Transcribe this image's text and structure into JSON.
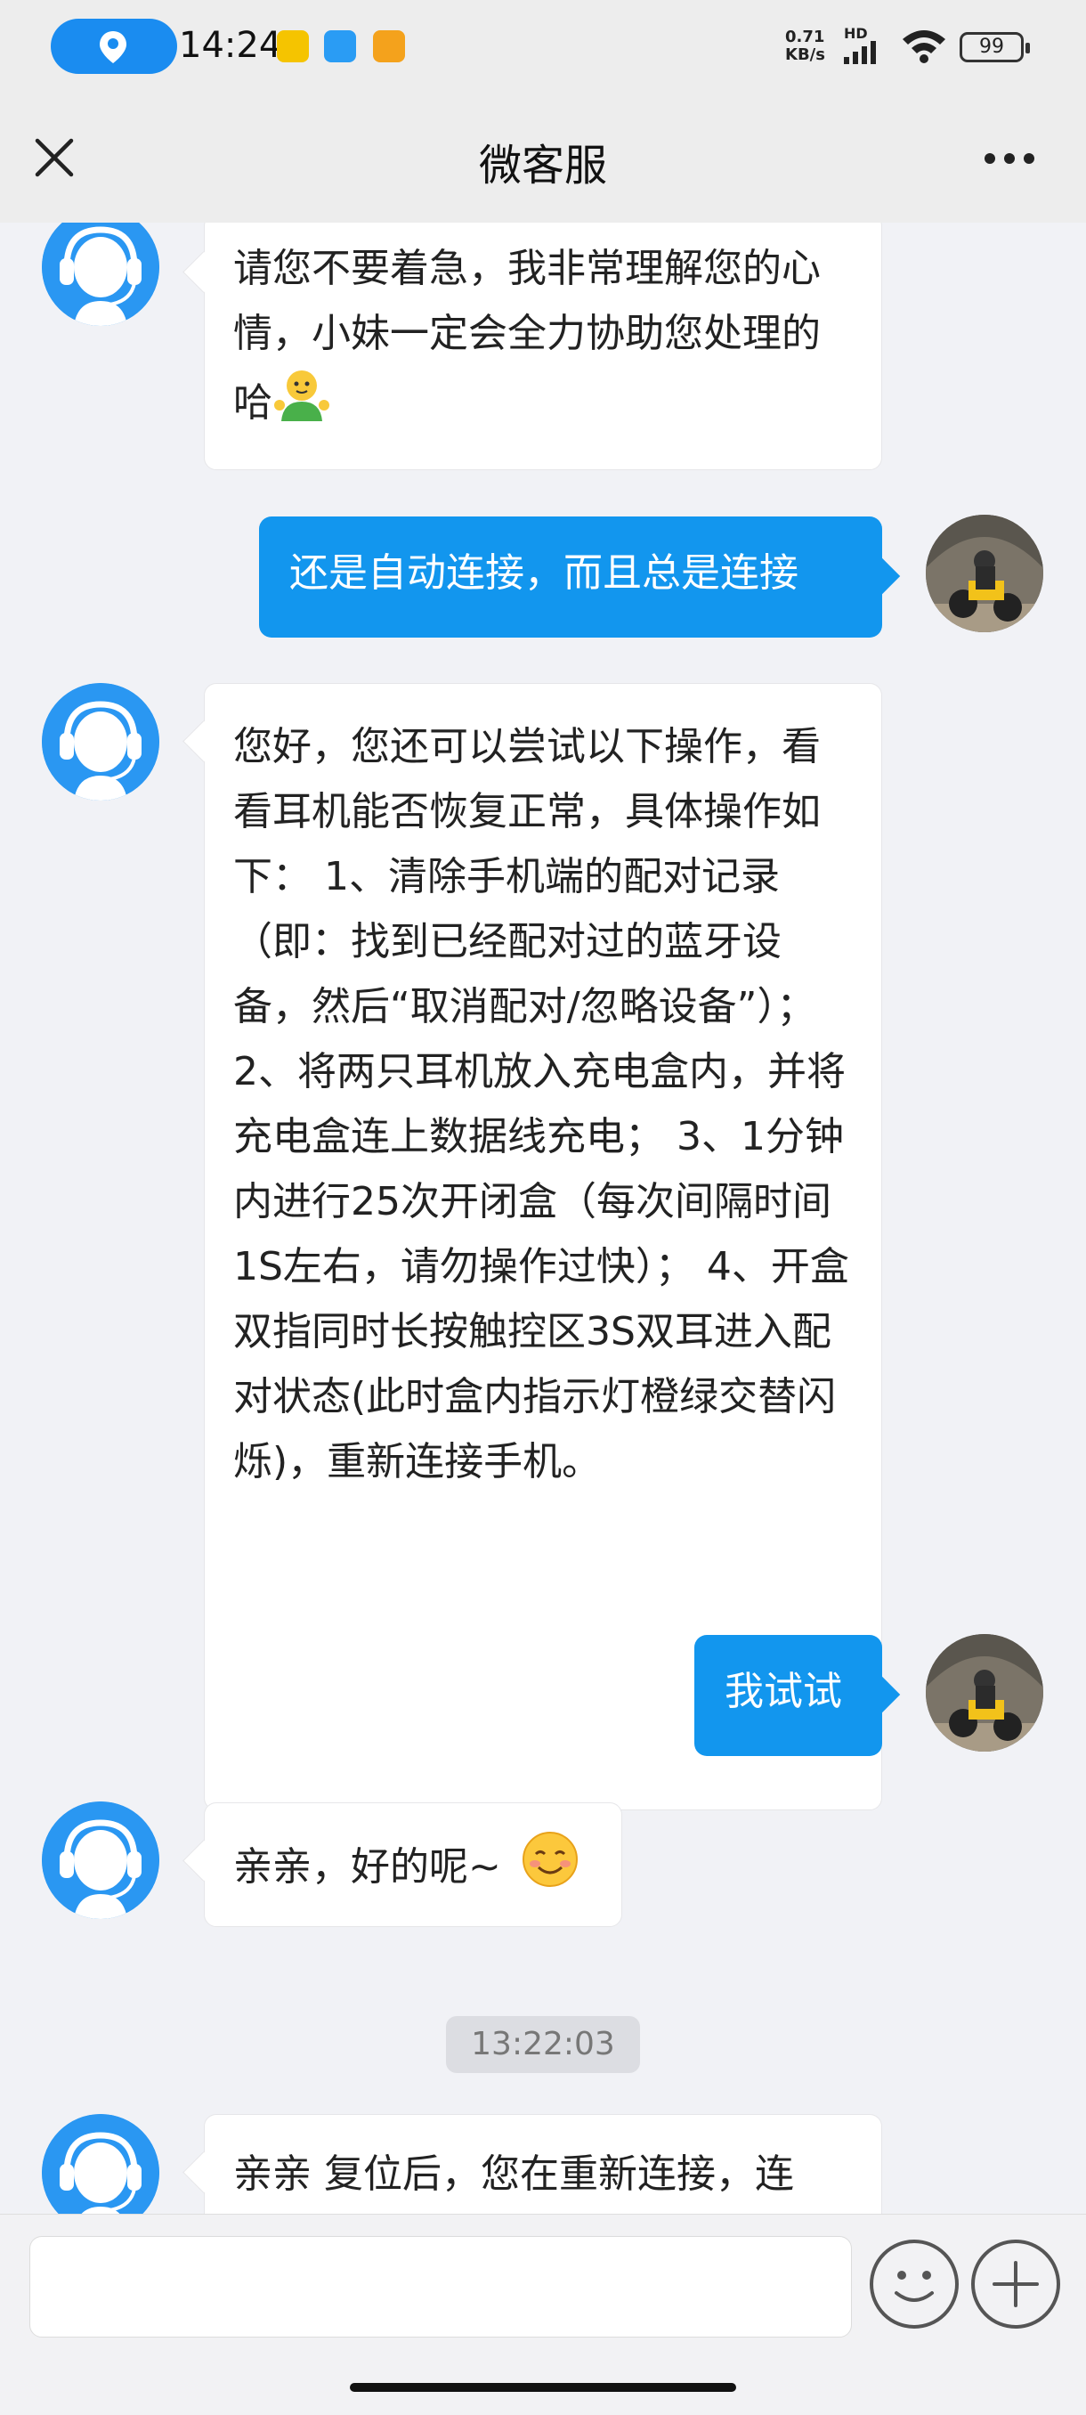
{
  "status_bar": {
    "time": "14:24",
    "network_speed_value": "0.71",
    "network_speed_unit": "KB/s",
    "network_type": "HD",
    "battery": "99"
  },
  "header": {
    "title": "微客服"
  },
  "messages": [
    {
      "side": "left",
      "text": "请您不要着急，我非常理解您的心情，小妹一定会全力协助您处理的哈"
    },
    {
      "side": "right",
      "text": "还是自动连接，而且总是连接"
    },
    {
      "side": "left",
      "text": "您好，您还可以尝试以下操作，看看耳机能否恢复正常，具体操作如下： 1、清除手机端的配对记录（即：找到已经配对过的蓝牙设备，然后“取消配对/忽略设备”）； 2、将两只耳机放入充电盒内，并将充电盒连上数据线充电； 3、1分钟内进行25次开闭盒（每次间隔时间1S左右，请勿操作过快）； 4、开盒双指同时长按触控区3S双耳进入配对状态(此时盒内指示灯橙绿交替闪烁)，重新连接手机。"
    },
    {
      "side": "right",
      "text": "我试试"
    },
    {
      "side": "left",
      "text": "亲亲，好的呢~"
    },
    {
      "side": "left",
      "text": "亲亲 复位后，您在重新连接，连"
    }
  ],
  "timestamp": "13:22:03",
  "input": {
    "placeholder": ""
  }
}
